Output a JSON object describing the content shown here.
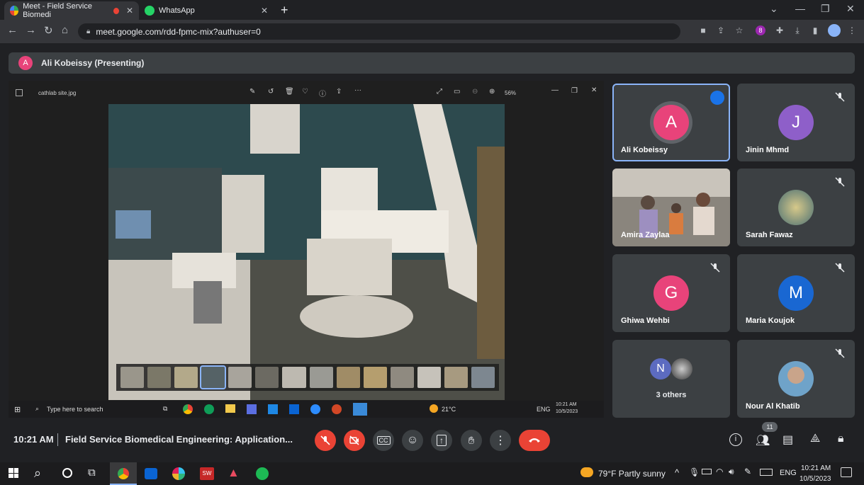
{
  "browser": {
    "tabs": [
      {
        "title": "Meet - Field Service Biomedi",
        "favicon": "google-meet-icon"
      },
      {
        "title": "WhatsApp",
        "favicon": "whatsapp-icon"
      }
    ],
    "url": "meet.google.com/rdd-fpmc-mix?authuser=0",
    "profile_badge": "8"
  },
  "meeting": {
    "presenter_initial": "A",
    "presenter_label": "Ali Kobeissy (Presenting)",
    "time": "10:21 AM",
    "title": "Field Service Biomedical Engineering: Application...",
    "participant_count": "11"
  },
  "viewer": {
    "filename": "cathlab site.jpg",
    "zoom": "56%"
  },
  "shared_taskbar": {
    "search_placeholder": "Type here to search",
    "weather": "21°C",
    "lang": "ENG",
    "time": "10:21 AM",
    "date": "10/5/2023"
  },
  "participants": [
    {
      "name": "Ali Kobeissy",
      "initial": "A",
      "color": "#e8437a",
      "active": true,
      "muted": false
    },
    {
      "name": "Jinin Mhmd",
      "initial": "J",
      "color": "#8e5fc9",
      "muted": true
    },
    {
      "name": "Amira Zaylaa",
      "video": true,
      "muted": false
    },
    {
      "name": "Sarah Fawaz",
      "photo": true,
      "muted": true
    },
    {
      "name": "Ghiwa Wehbi",
      "initial": "G",
      "color": "#e8437a",
      "muted": true
    },
    {
      "name": "Maria Koujok",
      "initial": "M",
      "color": "#1967d2",
      "muted": true
    },
    {
      "name": "3 others",
      "initial": "N",
      "color": "#5c6bc0",
      "muted": false
    },
    {
      "name": "Nour Al Khatib",
      "photo": true,
      "muted": true
    }
  ],
  "taskbar": {
    "weather": "79°F  Partly sunny",
    "lang": "ENG",
    "time": "10:21 AM",
    "date": "10/5/2023"
  }
}
